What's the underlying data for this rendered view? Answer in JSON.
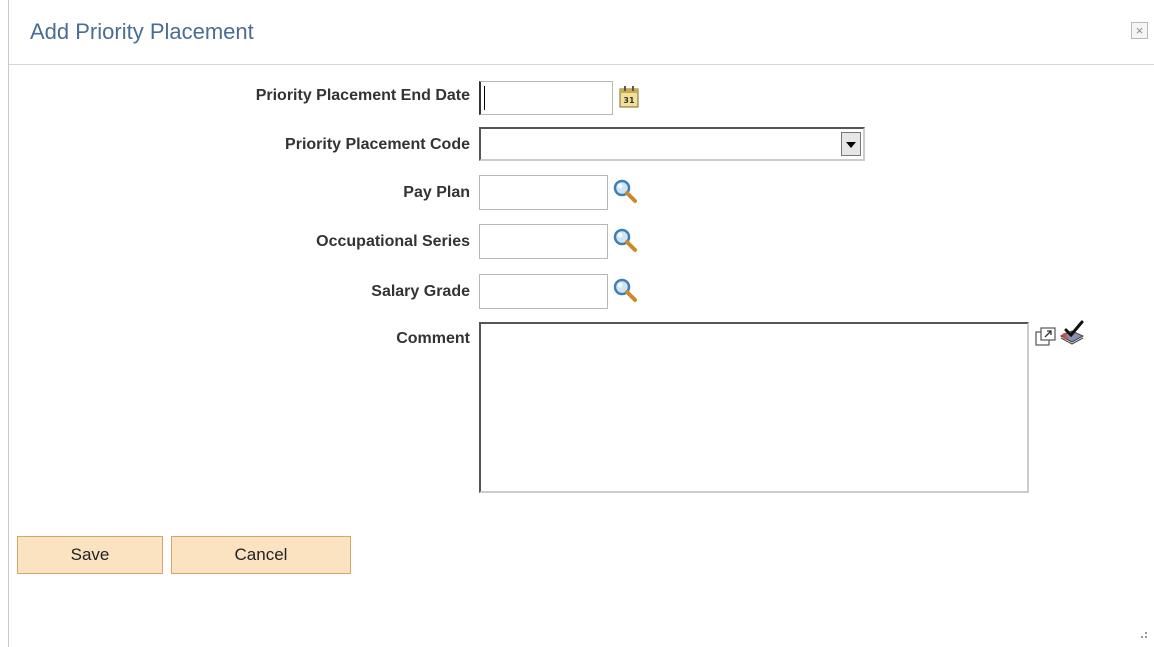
{
  "dialog": {
    "title": "Add Priority Placement",
    "close_label": "×"
  },
  "form": {
    "end_date_label": "Priority Placement End Date",
    "end_date_value": "",
    "code_label": "Priority Placement Code",
    "code_selected": "",
    "pay_plan_label": "Pay Plan",
    "pay_plan_value": "",
    "occupational_series_label": "Occupational Series",
    "occupational_series_value": "",
    "salary_grade_label": "Salary Grade",
    "salary_grade_value": "",
    "comment_label": "Comment",
    "comment_value": ""
  },
  "buttons": {
    "save_label": "Save",
    "cancel_label": "Cancel"
  },
  "icons": {
    "calendar": "calendar-icon",
    "lookup": "magnifier-icon",
    "expand": "expand-text-icon",
    "spellcheck": "spellcheck-icon"
  },
  "colors": {
    "title": "#4a6d93",
    "button_bg": "#fbe3c2",
    "button_border": "#d9a566"
  }
}
